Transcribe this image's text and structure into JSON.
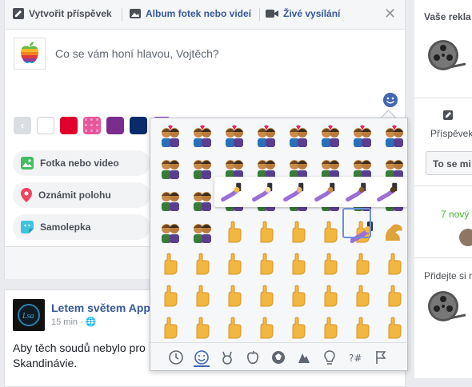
{
  "composer": {
    "tabs": {
      "create_post": "Vytvořit příspěvek",
      "album": "Album fotek nebo videí",
      "live": "Živé vysílání"
    },
    "placeholder": "Co se vám honí hlavou, Vojtěch?",
    "background_colors": [
      "#ffffff",
      "#e0002b",
      "#e8569a",
      "#7b2d8e",
      "#0a2b6b",
      "#8a3ab9"
    ],
    "options": [
      {
        "label": "Fotka nebo video",
        "icon": "photo-icon"
      },
      {
        "label": "Oznámit polohu",
        "icon": "location-pin-icon"
      },
      {
        "label": "Samolepka",
        "icon": "sticker-icon"
      }
    ]
  },
  "emoji_picker": {
    "categories": [
      "recent-icon",
      "smiley-icon",
      "animal-icon",
      "food-icon",
      "activity-icon",
      "travel-icon",
      "objects-icon",
      "symbols-icon",
      "flags-icon"
    ],
    "active_category": "smiley-icon",
    "tone_count": 6,
    "accent": "#4267b2"
  },
  "post": {
    "page_name": "Letem světem App",
    "time": "15 min ·",
    "text_line1": "Aby těch soudů nebylo pro",
    "text_line2": "Skandinávie."
  },
  "right_column": {
    "header": "Vaše rekla",
    "post_label": "Příspěvek",
    "button": "To se mi",
    "new_count": "7 nový",
    "add_label": "Přidejte si n"
  }
}
